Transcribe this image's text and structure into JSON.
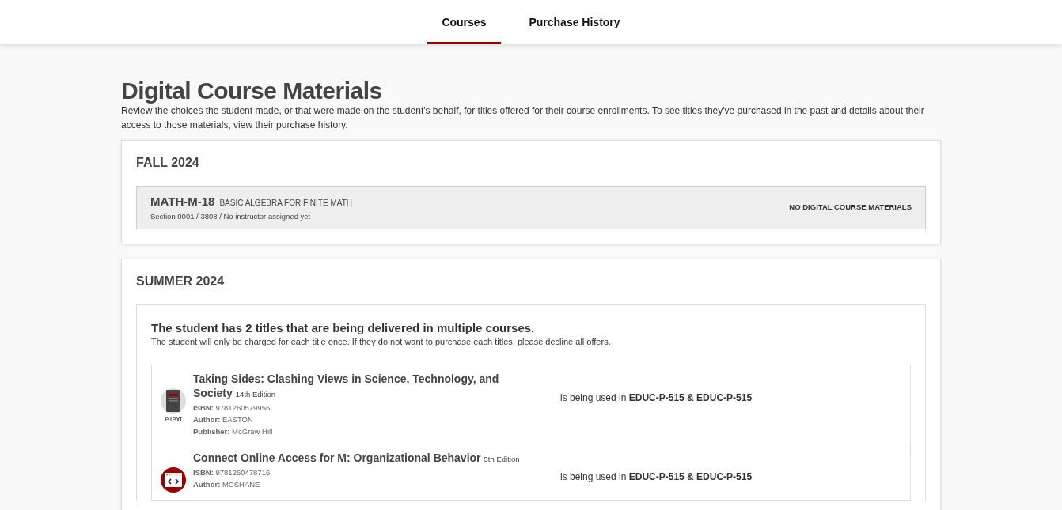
{
  "tabs": [
    {
      "label": "Courses",
      "selected": true
    },
    {
      "label": "Purchase History",
      "selected": false
    }
  ],
  "heading": "Digital Course Materials",
  "intro": "Review the choices the student made, or that were made on the student's behalf, for titles offered for their course enrollments. To see titles they've purchased in the past and details about their access to those materials, view their purchase history.",
  "terms": [
    {
      "title": "FALL 2024",
      "courses": [
        {
          "code": "MATH-M-18",
          "name": "BASIC ALGEBRA FOR FINITE MATH",
          "section": "Section 0001 / 3808 / No instructor assigned yet",
          "status": "NO DIGITAL COURSE MATERIALS"
        }
      ]
    },
    {
      "title": "SUMMER 2024",
      "notice": {
        "title": "The student has 2 titles that are being delivered in multiple courses.",
        "text": "The student will only be charged for each title once. If they do not want to purchase each titles, please decline all offers.",
        "items": [
          {
            "kind": "etext",
            "icon_label": "eText",
            "title": "Taking Sides: Clashing Views in Science, Technology, and Society",
            "edition": "14th Edition",
            "fields": [
              {
                "label": "ISBN:",
                "value": "9781260579956"
              },
              {
                "label": "Author:",
                "value": "EASTON"
              },
              {
                "label": "Publisher:",
                "value": "McGraw Hill"
              }
            ],
            "usage_label": "is being used in",
            "usage": "EDUC-P-515 & EDUC-P-515"
          },
          {
            "kind": "connect",
            "title": "Connect Online Access for M: Organizational Behavior",
            "edition": "5th Edition",
            "fields": [
              {
                "label": "ISBN:",
                "value": "9781260478716"
              },
              {
                "label": "Author:",
                "value": "MCSHANE"
              }
            ],
            "usage_label": "is being used in",
            "usage": "EDUC-P-515 & EDUC-P-515"
          }
        ]
      }
    }
  ]
}
